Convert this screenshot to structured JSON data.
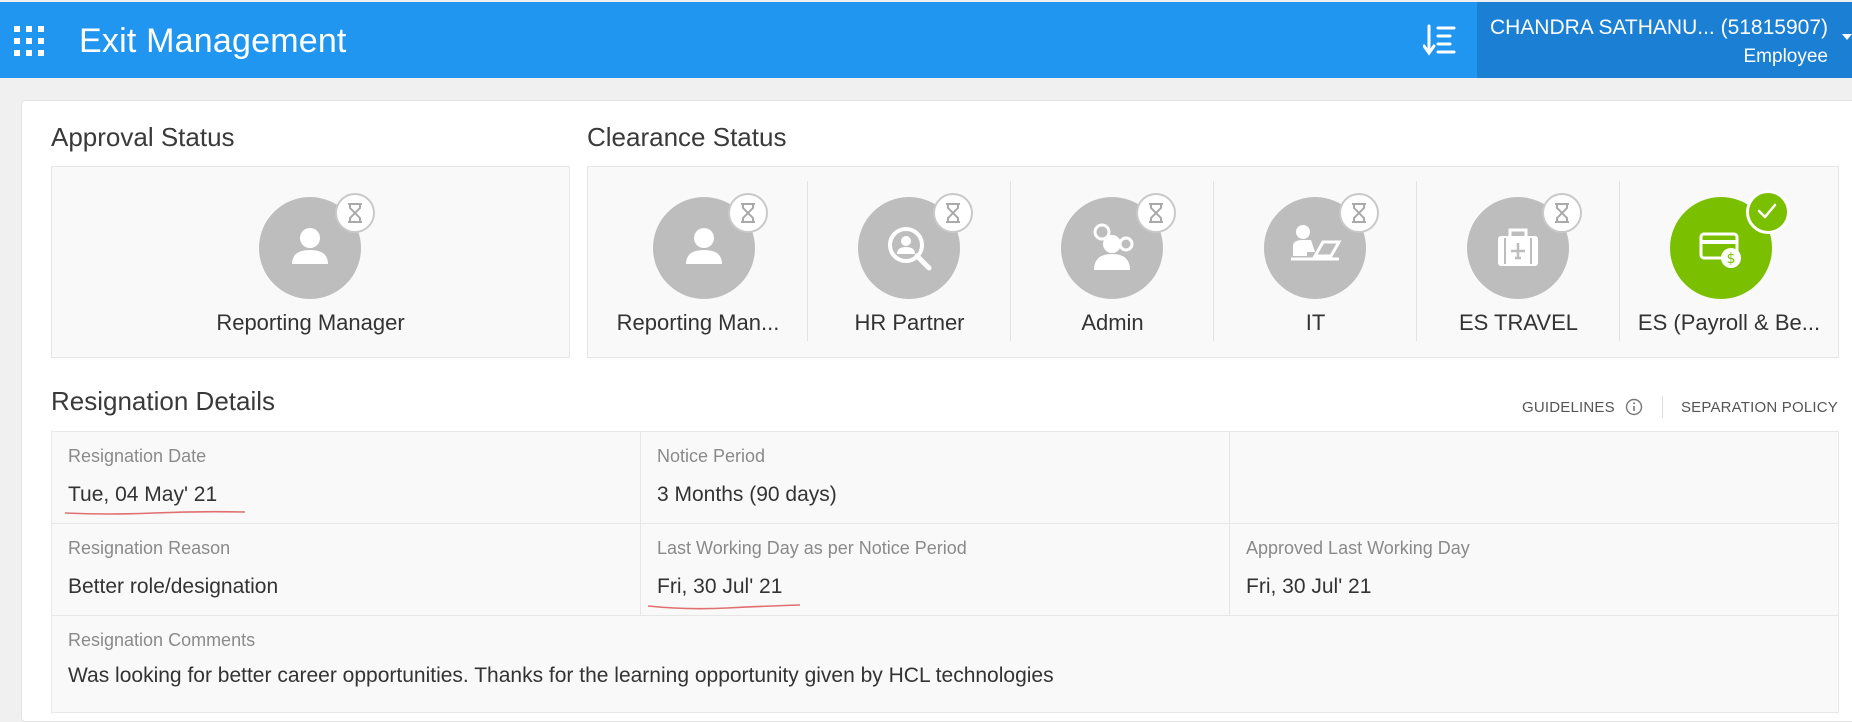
{
  "header": {
    "title": "Exit Management",
    "user_name": "CHANDRA SATHANU... (51815907)",
    "user_role": "Employee",
    "brand_color": "#2196f0"
  },
  "approval": {
    "title": "Approval Status",
    "items": [
      {
        "label": "Reporting Manager",
        "icon": "person-icon",
        "status": "pending"
      }
    ]
  },
  "clearance": {
    "title": "Clearance Status",
    "items": [
      {
        "label": "Reporting Man...",
        "icon": "person-icon",
        "status": "pending"
      },
      {
        "label": "HR Partner",
        "icon": "search-person-icon",
        "status": "pending"
      },
      {
        "label": "Admin",
        "icon": "admin-gears-icon",
        "status": "pending"
      },
      {
        "label": "IT",
        "icon": "laptop-user-icon",
        "status": "pending"
      },
      {
        "label": "ES TRAVEL",
        "icon": "suitcase-icon",
        "status": "pending"
      },
      {
        "label": "ES (Payroll & Be...",
        "icon": "payroll-card-icon",
        "status": "completed"
      }
    ]
  },
  "links": {
    "guidelines": "GUIDELINES",
    "separation_policy": "SEPARATION POLICY"
  },
  "resignation": {
    "title": "Resignation Details",
    "date_label": "Resignation Date",
    "date_value": "Tue, 04 May' 21",
    "notice_label": "Notice Period",
    "notice_value": "3 Months (90 days)",
    "reason_label": "Resignation Reason",
    "reason_value": "Better role/designation",
    "lwd_label": "Last Working Day as per Notice Period",
    "lwd_value": "Fri, 30 Jul' 21",
    "approved_lwd_label": "Approved Last Working Day",
    "approved_lwd_value": "Fri, 30 Jul' 21",
    "comments_label": "Resignation Comments",
    "comments_value": "Was looking for better career opportunities. Thanks for the learning opportunity given by HCL technologies"
  }
}
